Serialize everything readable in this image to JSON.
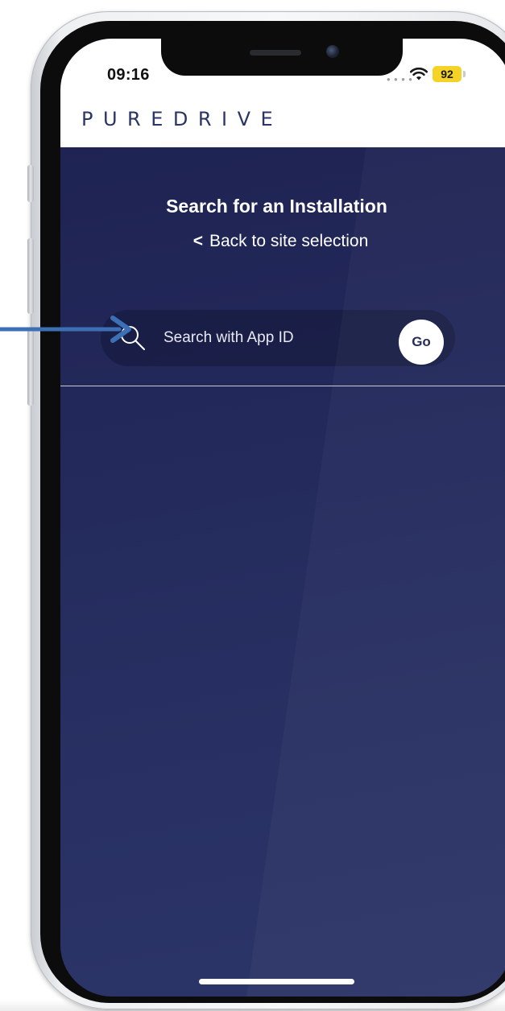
{
  "status_bar": {
    "time": "09:16",
    "battery_level": "92",
    "battery_color": "#f4d21f"
  },
  "brand": {
    "logo_text": "PUREDRIVE",
    "logo_color": "#2a3565"
  },
  "main": {
    "title": "Search for an Installation",
    "back_chevron": "<",
    "back_link_label": "Back to site selection",
    "background_color": "#222859"
  },
  "search": {
    "placeholder": "Search with App ID",
    "go_label": "Go"
  },
  "annotation": {
    "arrow_color": "#3d6fb5",
    "icon": "arrow-right-icon"
  }
}
